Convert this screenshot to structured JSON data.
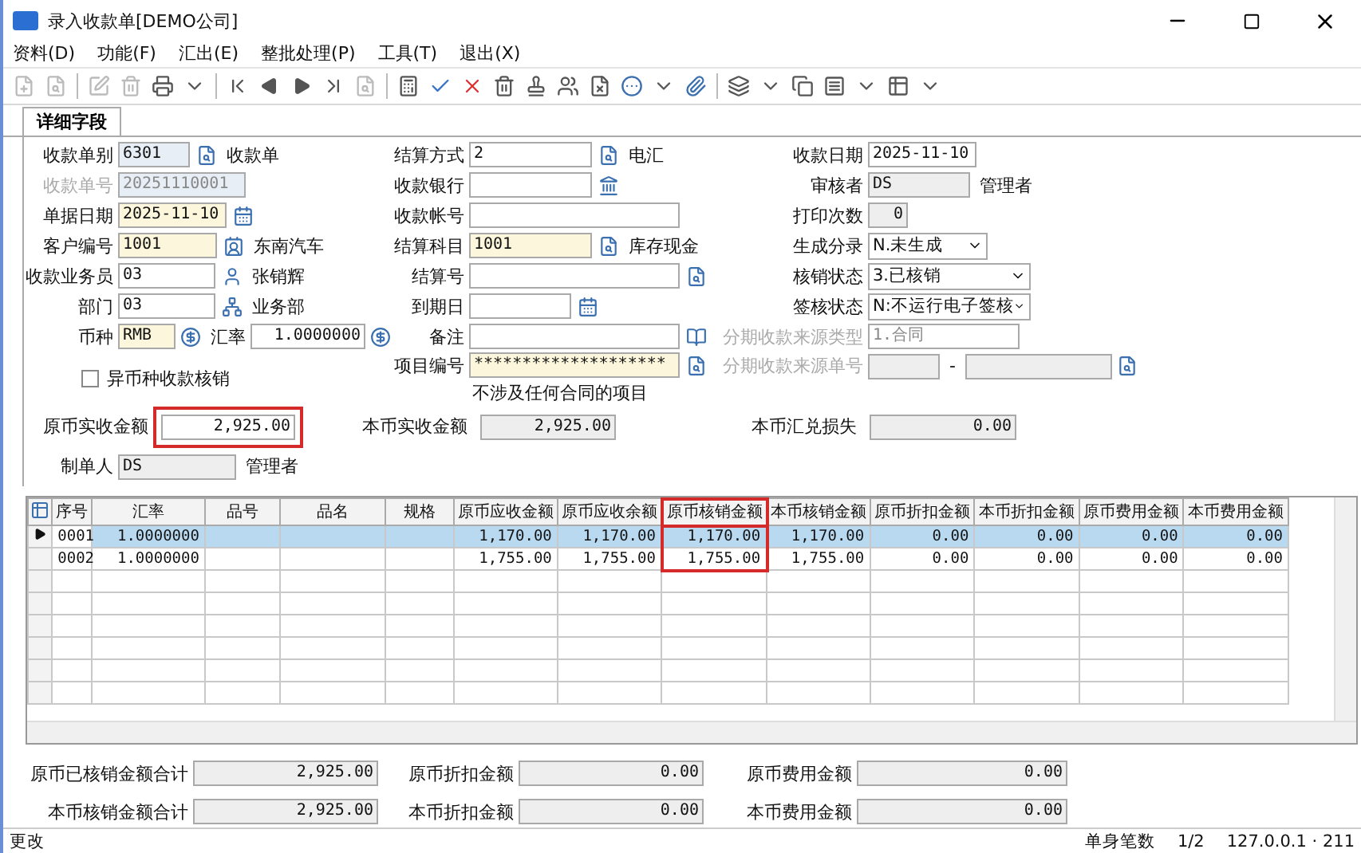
{
  "window": {
    "title": "录入收款单[DEMO公司]"
  },
  "menu": [
    "资料(D)",
    "功能(F)",
    "汇出(E)",
    "整批处理(P)",
    "工具(T)",
    "退出(X)"
  ],
  "tabs": [
    {
      "label": "详细字段",
      "selected": true
    }
  ],
  "form": {
    "left": [
      {
        "kind": "field",
        "label": "收款单别",
        "value": "6301",
        "disabled": false,
        "text": "收款单"
      },
      {
        "kind": "field",
        "label": "收款单号",
        "value": "20251110001",
        "disabled": true
      },
      {
        "kind": "field",
        "label": "单据日期",
        "value": "2025-11-10",
        "disabled": false
      },
      {
        "kind": "field",
        "label": "客户编号",
        "value": "1001",
        "disabled": false,
        "text": "东南汽车"
      },
      {
        "kind": "field",
        "label": "收款业务员",
        "value": "03",
        "disabled": false,
        "text": "张销辉"
      },
      {
        "kind": "field",
        "label": "部门",
        "value": "03",
        "disabled": false,
        "text": "业务部"
      },
      {
        "kind": "currency",
        "label": "币种",
        "value": "RMB",
        "disabled": false,
        "rate_label": "汇率",
        "rate_value": "1.0000000"
      },
      {
        "kind": "checkbox",
        "label": "异币种收款核销",
        "checked": false
      }
    ],
    "middle": [
      {
        "kind": "field",
        "label": "结算方式",
        "value": "2",
        "disabled": false,
        "text": "电汇"
      },
      {
        "kind": "field",
        "label": "收款银行",
        "disabled": false
      },
      {
        "kind": "field",
        "label": "收款帐号",
        "disabled": false
      },
      {
        "kind": "field",
        "label": "结算科目",
        "value": "1001",
        "disabled": false,
        "text": "库存现金"
      },
      {
        "kind": "field",
        "label": "结算号",
        "disabled": false
      },
      {
        "kind": "field",
        "label": "到期日",
        "disabled": false
      },
      {
        "kind": "field",
        "label": "备注",
        "disabled": false
      },
      {
        "kind": "field",
        "label": "项目编号",
        "value": "********************",
        "disabled": false
      },
      {
        "kind": "note",
        "text": "不涉及任何合同的项目"
      }
    ],
    "right": [
      {
        "kind": "field",
        "label": "收款日期",
        "value": "2025-11-10",
        "disabled": false
      },
      {
        "kind": "field",
        "label": "审核者",
        "value": "DS",
        "disabled": false,
        "text": "管理者"
      },
      {
        "kind": "field",
        "label": "打印次数",
        "value": "0",
        "disabled": false
      },
      {
        "kind": "dropdown",
        "label": "生成分录",
        "value": "N.未生成",
        "disabled": false
      },
      {
        "kind": "dropdown",
        "label": "核销状态",
        "value": "3.已核销",
        "disabled": false
      },
      {
        "kind": "dropdown",
        "label": "签核状态",
        "value": "N:不运行电子签核",
        "disabled": false
      },
      {
        "kind": "field",
        "label": "分期收款来源类型",
        "value": "1.合同",
        "disabled": true
      },
      {
        "kind": "range",
        "label": "分期收款来源单号",
        "separator": "-",
        "disabled": true
      }
    ],
    "amounts": [
      {
        "label": "原币实收金额",
        "value": "2,925.00",
        "highlighted": true
      },
      {
        "label": "本币实收金额",
        "value": "2,925.00",
        "highlighted": false
      },
      {
        "label": "本币汇兑损失",
        "value": "0.00",
        "highlighted": false
      }
    ],
    "creator": {
      "label": "制单人",
      "value": "DS",
      "text": "管理者"
    }
  },
  "table": {
    "columns": [
      {
        "label": "序号",
        "kind": "seq",
        "highlighted": false
      },
      {
        "label": "汇率",
        "kind": "rate",
        "highlighted": false
      },
      {
        "label": "品号",
        "kind": "text",
        "highlighted": false
      },
      {
        "label": "品名",
        "kind": "text",
        "highlighted": false
      },
      {
        "label": "规格",
        "kind": "text",
        "highlighted": false
      },
      {
        "label": "原币应收金额",
        "kind": "amount",
        "highlighted": false
      },
      {
        "label": "原币应收余额",
        "kind": "amount",
        "highlighted": false
      },
      {
        "label": "原币核销金额",
        "kind": "amount",
        "highlighted": true
      },
      {
        "label": "本币核销金额",
        "kind": "amount",
        "highlighted": false
      },
      {
        "label": "原币折扣金额",
        "kind": "amount",
        "highlighted": false
      },
      {
        "label": "本币折扣金额",
        "kind": "amount",
        "highlighted": false
      },
      {
        "label": "原币费用金额",
        "kind": "amount",
        "highlighted": false
      },
      {
        "label": "本币费用金额",
        "kind": "amount",
        "highlighted": false
      }
    ],
    "rows": [
      {
        "seq": "0001",
        "rate": "1.0000000",
        "amounts": [
          "1,170.00",
          "1,170.00",
          "1,170.00",
          "1,170.00",
          "0.00",
          "0.00",
          "0.00",
          "0.00"
        ],
        "selected": true
      },
      {
        "seq": "0002",
        "rate": "1.0000000",
        "amounts": [
          "1,755.00",
          "1,755.00",
          "1,755.00",
          "1,755.00",
          "0.00",
          "0.00",
          "0.00",
          "0.00"
        ],
        "selected": false
      }
    ]
  },
  "totals": [
    {
      "label": "原币已核销金额合计",
      "value": "2,925.00"
    },
    {
      "label": "原币折扣金额",
      "value": "0.00"
    },
    {
      "label": "原币费用金额",
      "value": "0.00"
    },
    {
      "label": "本币核销金额合计",
      "value": "2,925.00"
    },
    {
      "label": "本币折扣金额",
      "value": "0.00"
    },
    {
      "label": "本币费用金额",
      "value": "0.00"
    }
  ],
  "status_bar": {
    "mode": "更改",
    "count_label": "单身笔数",
    "count": "1/2",
    "host": "127.0.0.1 · 211"
  }
}
